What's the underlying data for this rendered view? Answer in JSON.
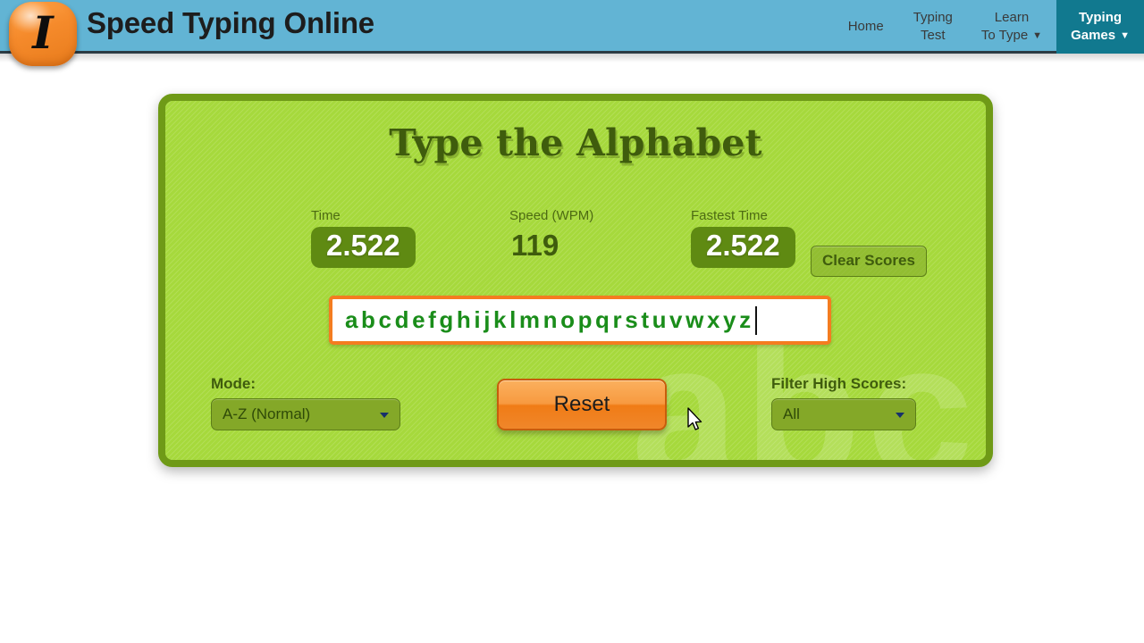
{
  "header": {
    "brand_title": "Speed Typing Online",
    "logo_glyph": "I",
    "nav": [
      {
        "line1": "Home",
        "line2": "",
        "caret": "",
        "active": false
      },
      {
        "line1": "Typing",
        "line2": "Test",
        "caret": "",
        "active": false
      },
      {
        "line1": "Learn",
        "line2": "To Type",
        "caret": "▼",
        "active": false
      },
      {
        "line1": "Typing",
        "line2": "Games",
        "caret": "▼",
        "active": true
      }
    ]
  },
  "game": {
    "title": "Type the Alphabet",
    "watermark": "abc",
    "stats": {
      "time_label": "Time",
      "time_value": "2.522",
      "speed_label": "Speed (WPM)",
      "speed_value": "119",
      "fastest_label": "Fastest Time",
      "fastest_value": "2.522"
    },
    "clear_scores_label": "Clear Scores",
    "input": {
      "typed_text": "abcdefghijklmnopqrstuvwxyz",
      "placeholder": ""
    },
    "mode": {
      "label": "Mode:",
      "selected": "A-Z (Normal)"
    },
    "filter": {
      "label": "Filter High Scores:",
      "selected": "All"
    },
    "reset_label": "Reset"
  },
  "colors": {
    "header_blue": "#62b4d4",
    "nav_active": "#11798f",
    "panel_green": "#a6d93c",
    "panel_border": "#6f9a17",
    "stat_box": "#5f8a12",
    "title_green": "#3f5c0d",
    "input_border_orange": "#f47c20",
    "typed_text_green": "#1a8d1a",
    "reset_orange": "#f79a40",
    "select_green": "#84a828"
  }
}
